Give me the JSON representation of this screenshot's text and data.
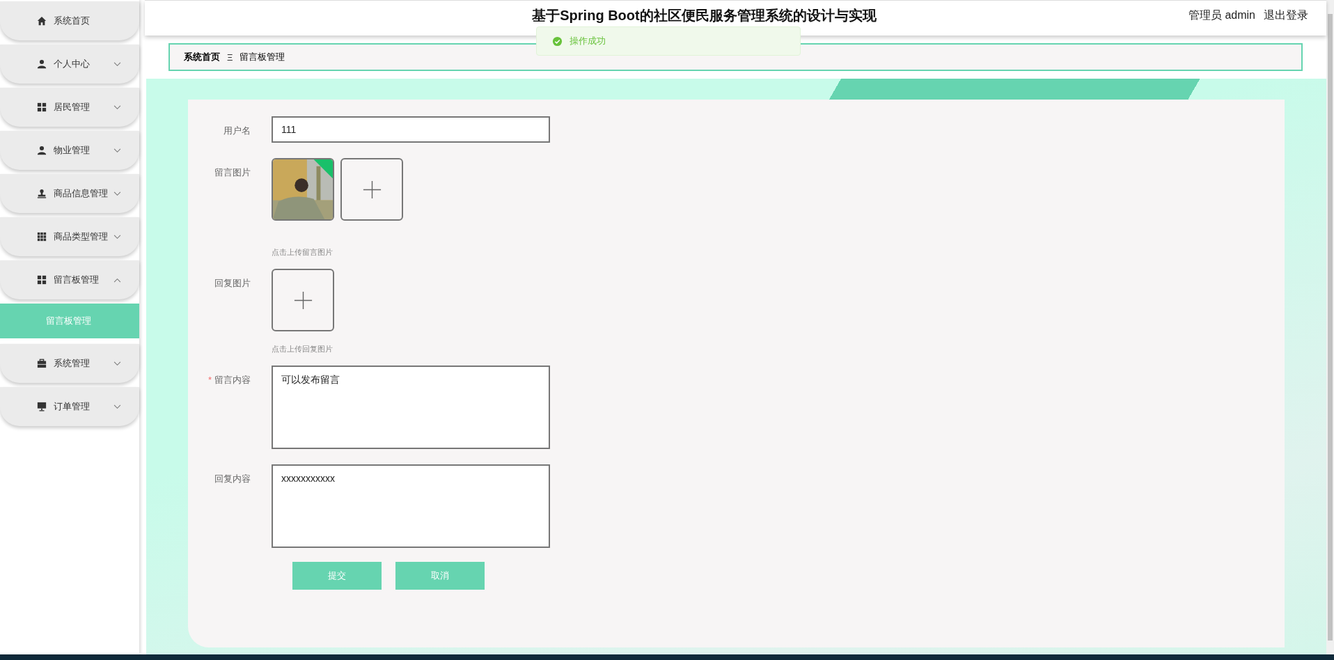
{
  "sidebar": {
    "items": [
      {
        "label": "系统首页",
        "kind": "link",
        "expanded": false
      },
      {
        "label": "个人中心",
        "kind": "submenu",
        "expanded": false
      },
      {
        "label": "居民管理",
        "kind": "submenu",
        "expanded": false
      },
      {
        "label": "物业管理",
        "kind": "submenu",
        "expanded": false
      },
      {
        "label": "商品信息管理",
        "kind": "submenu",
        "expanded": false
      },
      {
        "label": "商品类型管理",
        "kind": "submenu",
        "expanded": false
      },
      {
        "label": "留言板管理",
        "kind": "submenu",
        "expanded": true,
        "children": [
          {
            "label": "留言板管理",
            "selected": true
          }
        ]
      },
      {
        "label": "系统管理",
        "kind": "submenu",
        "expanded": false
      },
      {
        "label": "订单管理",
        "kind": "submenu",
        "expanded": false
      }
    ]
  },
  "header": {
    "title": "基于Spring Boot的社区便民服务管理系统的设计与实现",
    "user": "管理员 admin",
    "logout": "退出登录"
  },
  "toast": {
    "kind": "success",
    "text": "操作成功"
  },
  "breadcrumb": {
    "items": [
      "系统首页",
      "留言板管理"
    ],
    "separator": "Ξ"
  },
  "form": {
    "required_mark": "*",
    "fields": [
      {
        "label": "用户名",
        "kind": "text",
        "required": false,
        "value": "111"
      },
      {
        "label": "留言图片",
        "required": false,
        "hint": "点击上传留言图片"
      },
      {
        "label": "回复图片",
        "required": false,
        "hint": "点击上传回复图片"
      },
      {
        "label": "留言内容",
        "kind": "textarea",
        "required": true,
        "value": "可以发布留言"
      },
      {
        "label": "回复内容",
        "kind": "textarea",
        "required": false,
        "value": "xxxxxxxxxxx"
      }
    ],
    "buttons": [
      "提交",
      "取消"
    ]
  }
}
